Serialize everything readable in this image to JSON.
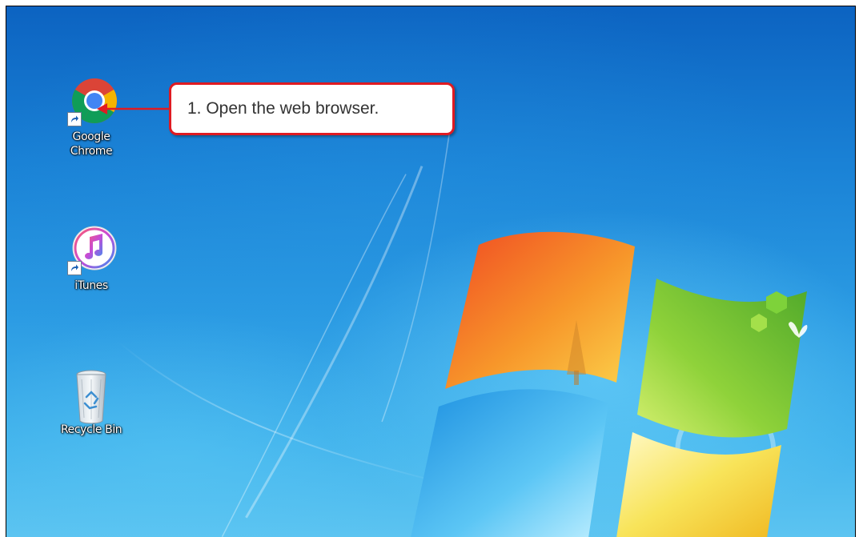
{
  "desktop": {
    "icons": [
      {
        "label": "Google\nChrome",
        "icon": "chrome-icon"
      },
      {
        "label": "iTunes",
        "icon": "itunes-icon"
      },
      {
        "label": "Recycle Bin",
        "icon": "recycle-bin-icon"
      }
    ]
  },
  "callout": {
    "text": "1. Open the web browser.",
    "border_color": "#e01b22"
  },
  "colors": {
    "wallpaper_top": "#0c63c1",
    "wallpaper_bottom": "#5cc4f1",
    "logo_red": "#f25022",
    "logo_green": "#7fba00",
    "logo_blue": "#00a4ef",
    "logo_yellow": "#ffb900"
  }
}
